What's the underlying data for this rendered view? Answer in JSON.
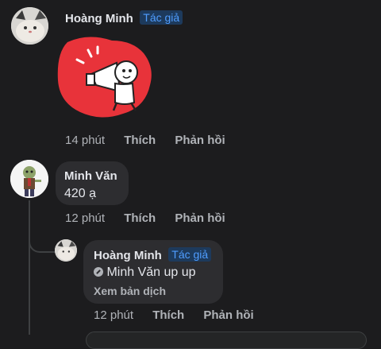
{
  "comments": [
    {
      "author": "Hoàng Minh",
      "badge": "Tác giả",
      "time": "14 phút",
      "like": "Thích",
      "reply": "Phản hồi",
      "sticker": "megaphone-sticker"
    },
    {
      "author": "Minh Văn",
      "text": "420 ạ",
      "time": "12 phút",
      "like": "Thích",
      "reply": "Phản hồi"
    },
    {
      "author": "Hoàng Minh",
      "badge": "Tác giả",
      "mention": "Minh Văn",
      "text": "up up",
      "translate": "Xem bản dịch",
      "time": "12 phút",
      "like": "Thích",
      "reply": "Phản hồi"
    }
  ],
  "colors": {
    "background": "#1c1c1e",
    "bubble": "#2d2d30",
    "badge_bg": "#1d3a5c",
    "badge_text": "#4f9dff",
    "sticker_red": "#e8333a"
  }
}
